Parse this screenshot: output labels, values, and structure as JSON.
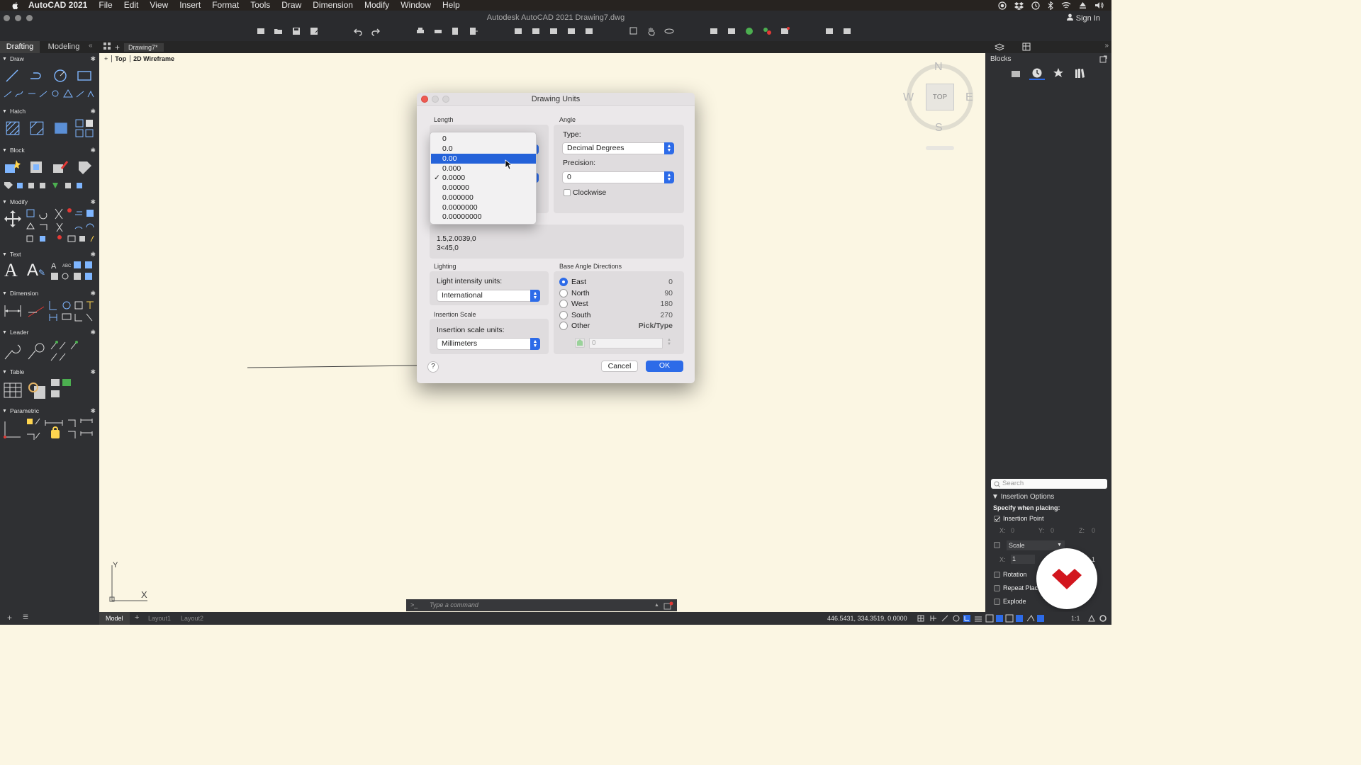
{
  "menubar": {
    "app_name": "AutoCAD 2021",
    "items": [
      "File",
      "Edit",
      "View",
      "Insert",
      "Format",
      "Tools",
      "Draw",
      "Dimension",
      "Modify",
      "Window",
      "Help"
    ]
  },
  "window": {
    "title": "Autodesk AutoCAD 2021    Drawing7.dwg",
    "sign_in": "Sign In"
  },
  "workspace_tabs": [
    "Drafting",
    "Modeling"
  ],
  "document_tab": "Drawing7*",
  "viewport_label": {
    "view": "Top",
    "style": "2D Wireframe"
  },
  "tool_sections": [
    "Draw",
    "Hatch",
    "Block",
    "Modify",
    "Text",
    "Dimension",
    "Leader",
    "Table",
    "Parametric"
  ],
  "viewcube": {
    "north": "N",
    "south": "S",
    "east": "E",
    "west": "W",
    "face": "TOP"
  },
  "ucs": {
    "x": "X",
    "y": "Y"
  },
  "dialog": {
    "title": "Drawing Units",
    "length_label": "Length",
    "angle_label": "Angle",
    "type_label": "Type:",
    "type_value": "Decimal Degrees",
    "precision_label": "Precision:",
    "precision_value": "0",
    "clockwise_label": "Clockwise",
    "sample_line1": "1.5,2.0039,0",
    "sample_line2": "3<45,0",
    "lighting_label": "Lighting",
    "light_units_label": "Light intensity units:",
    "light_units_value": "International",
    "insertion_label": "Insertion Scale",
    "insertion_units_label": "Insertion scale units:",
    "insertion_units_value": "Millimeters",
    "base_angle_label": "Base Angle Directions",
    "directions": [
      {
        "name": "East",
        "value": "0",
        "selected": true
      },
      {
        "name": "North",
        "value": "90",
        "selected": false
      },
      {
        "name": "West",
        "value": "180",
        "selected": false
      },
      {
        "name": "South",
        "value": "270",
        "selected": false
      },
      {
        "name": "Other",
        "value": "Pick/Type",
        "selected": false
      }
    ],
    "other_angle_placeholder": "0",
    "help": "?",
    "cancel": "Cancel",
    "ok": "OK"
  },
  "precision_dropdown": {
    "options": [
      "0",
      "0.0",
      "0.00",
      "0.000",
      "0.0000",
      "0.00000",
      "0.000000",
      "0.0000000",
      "0.00000000"
    ],
    "highlighted": "0.00",
    "checked": "0.0000"
  },
  "blocks_palette": {
    "title": "Blocks",
    "search_placeholder": "Search",
    "insertion_options": "Insertion Options",
    "specify_when_placing": "Specify when placing:",
    "insertion_point": "Insertion Point",
    "x_label": "X:",
    "y_label": "Y:",
    "z_label": "Z:",
    "ip_x": "0",
    "ip_y": "0",
    "ip_z": "0",
    "scale_label": "Scale",
    "scale_x": "1",
    "scale_partial": "1",
    "rotation": "Rotation",
    "repeat_placement": "Repeat Place",
    "explode": "Explode"
  },
  "command_line": {
    "placeholder": "Type a command",
    "prompt": ">_"
  },
  "status_bar": {
    "tabs": [
      "Model",
      "Layout1",
      "Layout2"
    ],
    "coordinates": "446.5431, 334.3519, 0.0000",
    "scale": "1:1"
  },
  "colors": {
    "accent": "#2D6BE8",
    "canvas": "#FBF6E3",
    "panel": "#2F3033",
    "close": "#EE5A52"
  }
}
